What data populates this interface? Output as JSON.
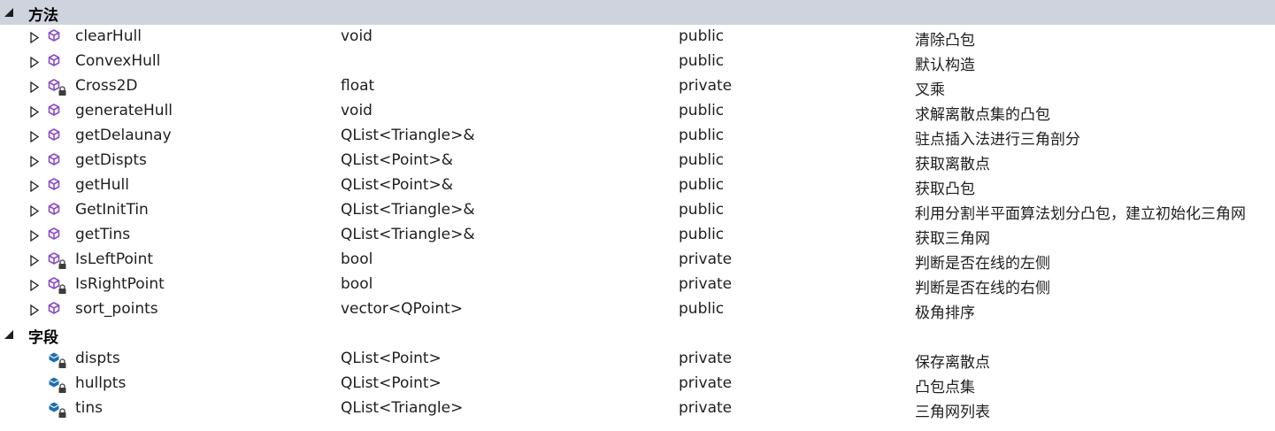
{
  "colors": {
    "method_icon": "#8a4bc9",
    "field_icon": "#1e6fb0",
    "header_bg": "#cfd3de",
    "lock": "#3c3c3c"
  },
  "groups": [
    {
      "label": "方法",
      "items": [
        {
          "name": "clearHull",
          "type": "void",
          "access": "public",
          "description": "清除凸包"
        },
        {
          "name": "ConvexHull",
          "type": "",
          "access": "public",
          "description": "默认构造"
        },
        {
          "name": "Cross2D",
          "type": "float",
          "access": "private",
          "description": "叉乘"
        },
        {
          "name": "generateHull",
          "type": "void",
          "access": "public",
          "description": "求解离散点集的凸包"
        },
        {
          "name": "getDelaunay",
          "type": "QList<Triangle>&",
          "access": "public",
          "description": "驻点插入法进行三角剖分"
        },
        {
          "name": "getDispts",
          "type": "QList<Point>&",
          "access": "public",
          "description": "获取离散点"
        },
        {
          "name": "getHull",
          "type": "QList<Point>&",
          "access": "public",
          "description": "获取凸包"
        },
        {
          "name": "GetInitTin",
          "type": "QList<Triangle>&",
          "access": "public",
          "description": "利用分割半平面算法划分凸包，建立初始化三角网"
        },
        {
          "name": "getTins",
          "type": "QList<Triangle>&",
          "access": "public",
          "description": "获取三角网"
        },
        {
          "name": "IsLeftPoint",
          "type": "bool",
          "access": "private",
          "description": "判断是否在线的左侧"
        },
        {
          "name": "IsRightPoint",
          "type": "bool",
          "access": "private",
          "description": "判断是否在线的右侧"
        },
        {
          "name": "sort_points",
          "type": "vector<QPoint>",
          "access": "public",
          "description": "极角排序"
        }
      ]
    },
    {
      "label": "字段",
      "items": [
        {
          "name": "dispts",
          "type": "QList<Point>",
          "access": "private",
          "description": "保存离散点"
        },
        {
          "name": "hullpts",
          "type": "QList<Point>",
          "access": "private",
          "description": "凸包点集"
        },
        {
          "name": "tins",
          "type": "QList<Triangle>",
          "access": "private",
          "description": "三角网列表"
        }
      ]
    }
  ]
}
